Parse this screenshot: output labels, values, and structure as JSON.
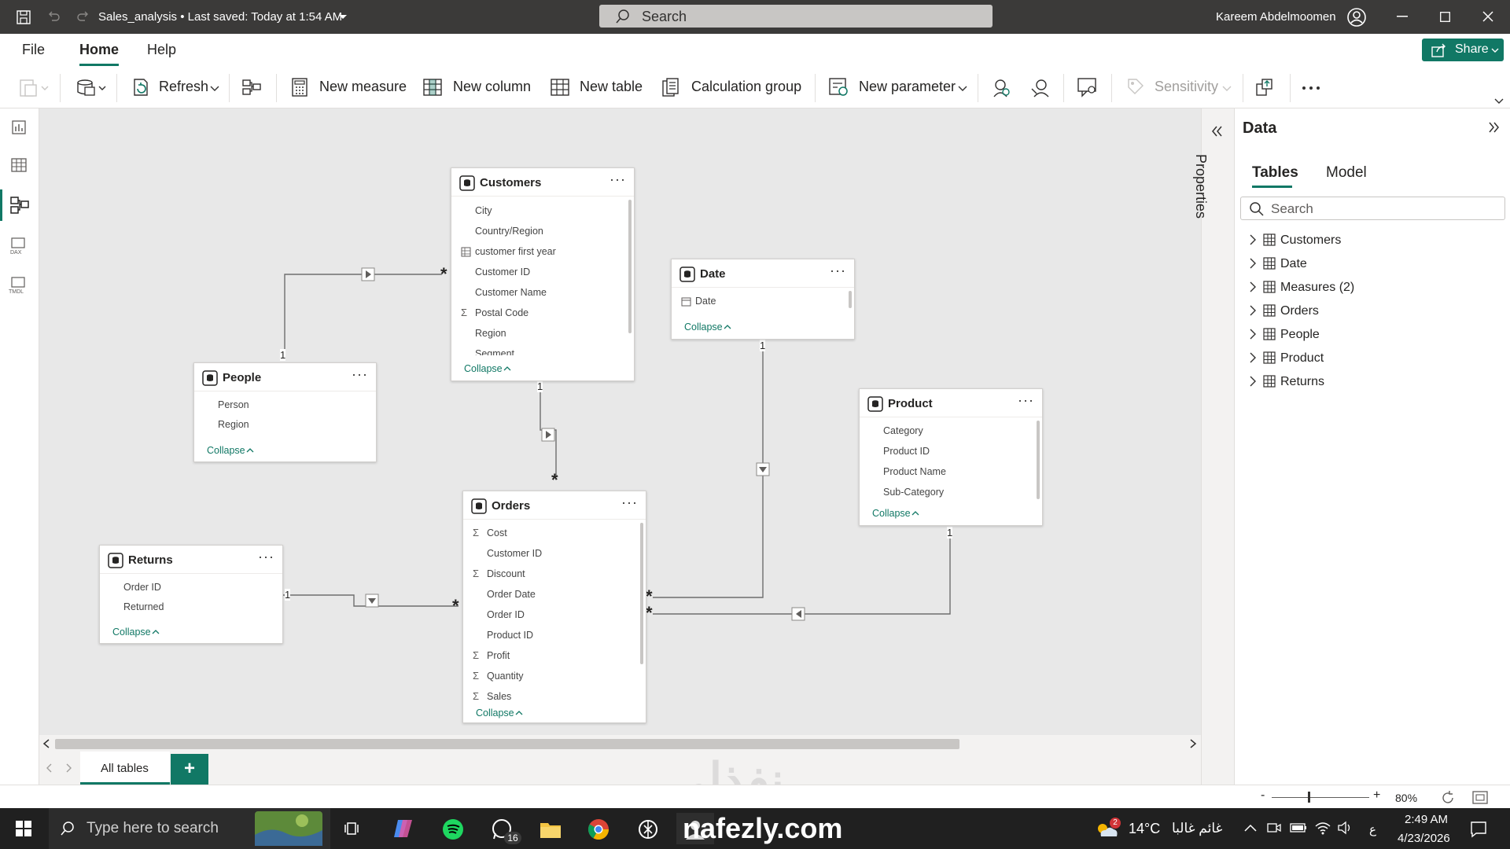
{
  "titlebar": {
    "doc_title": "Sales_analysis • Last saved: Today at 1:54 AM",
    "search_placeholder": "Search",
    "user_name": "Kareem Abdelmoomen"
  },
  "menu": {
    "file": "File",
    "home": "Home",
    "help": "Help",
    "share": "Share"
  },
  "ribbon": {
    "refresh": "Refresh",
    "new_measure": "New measure",
    "new_column": "New column",
    "new_table": "New table",
    "calculation_group": "Calculation group",
    "new_parameter": "New parameter",
    "sensitivity": "Sensitivity"
  },
  "tables": {
    "customers": {
      "title": "Customers",
      "fields": [
        "City",
        "Country/Region",
        "customer first year",
        "Customer ID",
        "Customer Name",
        "Postal Code",
        "Region",
        "Segment"
      ]
    },
    "date": {
      "title": "Date",
      "fields": [
        "Date"
      ]
    },
    "people": {
      "title": "People",
      "fields": [
        "Person",
        "Region"
      ]
    },
    "product": {
      "title": "Product",
      "fields": [
        "Category",
        "Product ID",
        "Product Name",
        "Sub-Category"
      ]
    },
    "returns": {
      "title": "Returns",
      "fields": [
        "Order ID",
        "Returned"
      ]
    },
    "orders": {
      "title": "Orders",
      "fields": [
        "Cost",
        "Customer ID",
        "Discount",
        "Order Date",
        "Order ID",
        "Product ID",
        "Profit",
        "Quantity",
        "Sales"
      ]
    },
    "collapse": "Collapse",
    "one": "1",
    "many": "*"
  },
  "tabs": {
    "all_tables": "All tables",
    "add": "+"
  },
  "properties_label": "Properties",
  "data_pane": {
    "title": "Data",
    "tab_tables": "Tables",
    "tab_model": "Model",
    "search_placeholder": "Search",
    "items": [
      "Customers",
      "Date",
      "Measures (2)",
      "Orders",
      "People",
      "Product",
      "Returns"
    ]
  },
  "status": {
    "zoom": "80%"
  },
  "watermark": {
    "arabic": "نفذلي",
    "url": "nafezly.com"
  },
  "taskbar": {
    "search_placeholder": "Type here to search",
    "whatsapp_badge": "16",
    "weather_badge": "2",
    "temperature": "14°C",
    "weather_text": "غائم غالبا",
    "lang": "ع",
    "time": "2:49 AM",
    "date": "4/23/2026"
  },
  "colors": {
    "accent": "#117865",
    "titlebar": "#3b3a39",
    "taskbar": "#202020"
  }
}
